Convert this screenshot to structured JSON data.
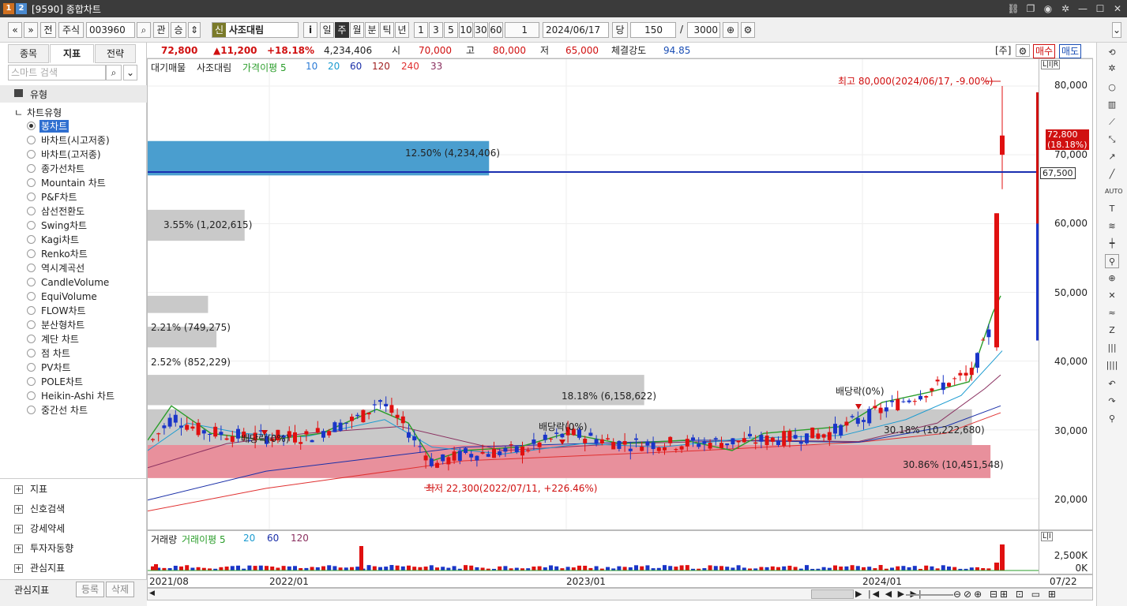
{
  "window": {
    "badge1": "1",
    "badge2": "2",
    "title": "[9590] 종합차트"
  },
  "toolbar": {
    "btn_back": "«",
    "btn_down": "»",
    "btn_prev": "전",
    "market": "주식",
    "code": "003960",
    "btn_rel": "관",
    "btn_seung": "승",
    "badge_new": "신",
    "stock_name": "사조대림",
    "btn_info": "i",
    "periods": [
      "일",
      "주",
      "월",
      "분",
      "틱",
      "년"
    ],
    "active_period": "주",
    "intervals": [
      "1",
      "3",
      "5",
      "10",
      "30",
      "60"
    ],
    "interval_value": "1",
    "date": "2024/06/17",
    "btn_dang": "당",
    "count": "150",
    "slash": "/",
    "total": "3000"
  },
  "left": {
    "tabs": [
      "종목",
      "지표",
      "전략"
    ],
    "active_tab": "지표",
    "search_placeholder": "스마트 검색",
    "section": "유형",
    "subsection": "차트유형",
    "chart_types": [
      "봉차트",
      "바차트(시고저종)",
      "바차트(고저종)",
      "종가선차트",
      "Mountain 차트",
      "P&F차트",
      "삼선전환도",
      "Swing차트",
      "Kagi차트",
      "Renko차트",
      "역시계곡선",
      "CandleVolume",
      "EquiVolume",
      "FLOW차트",
      "분산형차트",
      "계단 차트",
      "점 차트",
      "PV차트",
      "POLE차트",
      "Heikin-Ashi 차트",
      "중간선 차트"
    ],
    "selected_type": "봉차트",
    "groups": [
      "지표",
      "신호검색",
      "강세약세",
      "투자자동향",
      "관심지표"
    ],
    "footer_label": "관심지표",
    "footer_btn1": "등록",
    "footer_btn2": "삭제"
  },
  "quote": {
    "price": "72,800",
    "change": "▲11,200",
    "pct": "+18.18%",
    "volume": "4,234,406",
    "open_label": "시",
    "open": "70,000",
    "high_label": "고",
    "high": "80,000",
    "low_label": "저",
    "low": "65,000",
    "strength_label": "체결강도",
    "strength": "94.85",
    "mode": "[주]",
    "buy": "매수",
    "sell": "매도"
  },
  "legend": {
    "items": [
      "대기매물",
      "사조대림",
      "가격이평 5",
      "10",
      "20",
      "60",
      "120",
      "240",
      "33"
    ],
    "colors": [
      "#222",
      "#222",
      "#2a9d2a",
      "#2b7bd6",
      "#1b9bd0",
      "#1a2fa8",
      "#a02020",
      "#e03030",
      "#8a3060"
    ]
  },
  "price_labels": {
    "high_note": "최고 80,000(2024/06/17, -9.00%)",
    "low_note": "최저 22,300(2022/07/11, +226.46%)",
    "dividends": [
      "배당락(0%)",
      "배당락(0%)",
      "배당락(0%)"
    ],
    "current": "72,800",
    "current_pct": "(18.18%)",
    "hline": "67,500"
  },
  "profile": [
    {
      "label": "12.50% (4,234,406)",
      "pct": 12.5
    },
    {
      "label": "3.55% (1,202,615)",
      "pct": 3.55
    },
    {
      "label": "2.21% (749,275)",
      "pct": 2.21
    },
    {
      "label": "2.52% (852,229)",
      "pct": 2.52
    },
    {
      "label": "18.18% (6,158,622)",
      "pct": 18.18
    },
    {
      "label": "30.18% (10,222,680)",
      "pct": 30.18
    },
    {
      "label": "30.86% (10,451,548)",
      "pct": 30.86
    }
  ],
  "yaxis": {
    "ticks": [
      "80,000",
      "70,000",
      "60,000",
      "50,000",
      "40,000",
      "30,000",
      "20,000"
    ],
    "unit_badge": "L|I|R"
  },
  "volume": {
    "legend": [
      "거래량",
      "거래이평 5",
      "20",
      "60",
      "120"
    ],
    "ticks": [
      "2,500K",
      "0K"
    ]
  },
  "xaxis": {
    "ticks": [
      "2021/08",
      "2022/01",
      "2023/01",
      "2024/01"
    ],
    "last": "07/22"
  },
  "chart_data": {
    "type": "candlestick",
    "title": "사조대림",
    "ylim": [
      17000,
      85000
    ],
    "x_ticks": [
      "2021/08",
      "2022/01",
      "2023/01",
      "2024/01"
    ],
    "high": 80000,
    "low": 22300,
    "last": 72800,
    "hline": 67500,
    "profile_pct": [
      12.5,
      3.55,
      2.21,
      2.52,
      18.18,
      30.18,
      30.86
    ]
  }
}
